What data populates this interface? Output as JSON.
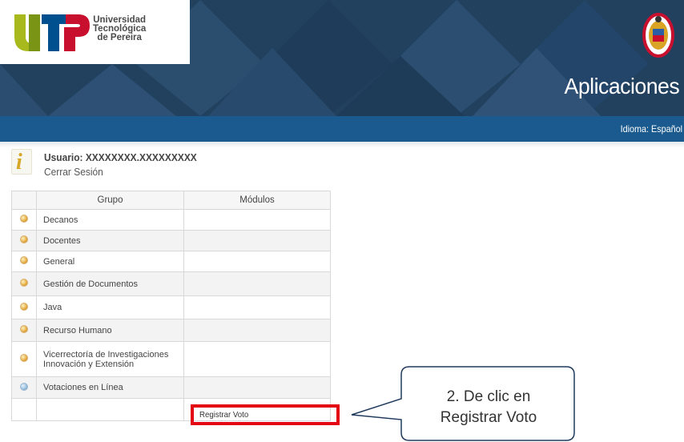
{
  "header": {
    "university_lines": [
      "Universidad",
      "Tecnológica",
      "de Pereira"
    ],
    "section_title": "Aplicaciones",
    "language_label": "Idioma: Español"
  },
  "user": {
    "label": "Usuario: XXXXXXXX.XXXXXXXXX",
    "logout": "Cerrar Sesión"
  },
  "table": {
    "headers": [
      "",
      "Grupo",
      "Módulos"
    ],
    "rows": [
      {
        "group": "Decanos",
        "module": "",
        "bullet": "orange"
      },
      {
        "group": "Docentes",
        "module": "",
        "bullet": "orange"
      },
      {
        "group": "General",
        "module": "",
        "bullet": "orange"
      },
      {
        "group": "Gestión de Documentos",
        "module": "",
        "bullet": "orange"
      },
      {
        "group": "Java",
        "module": "",
        "bullet": "orange"
      },
      {
        "group": "Recurso Humano",
        "module": "",
        "bullet": "orange"
      },
      {
        "group": "Vicerrectoría de Investigaciones Innovación y Extensión",
        "group_line1": "Vicerrectoría de Investigaciones",
        "group_line2": "Innovación y Extensión",
        "module": "",
        "bullet": "orange"
      },
      {
        "group": "Votaciones en Línea",
        "module": "",
        "bullet": "blue"
      },
      {
        "group": "",
        "module": "Registrar Voto",
        "bullet": "none"
      }
    ]
  },
  "callout": {
    "line1": "2. De clic en",
    "line2": "Registrar Voto"
  },
  "colors": {
    "header_dark": "#22415f",
    "language_bar": "#1a5a8e",
    "highlight": "#e30613"
  }
}
